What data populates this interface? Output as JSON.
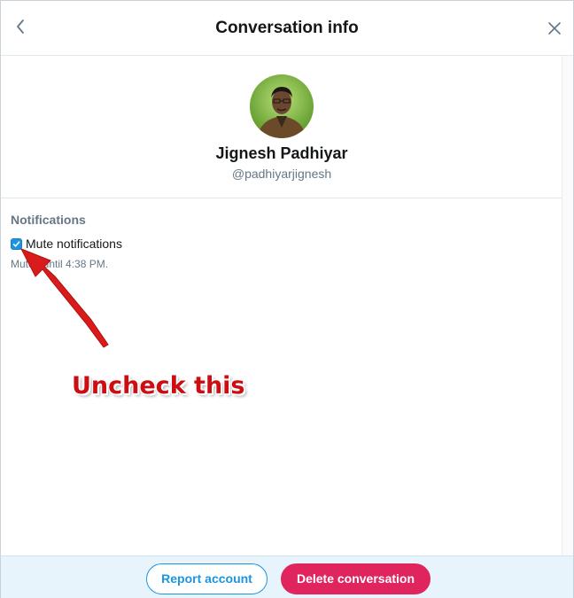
{
  "header": {
    "title": "Conversation info",
    "back_icon": "chevron-left-icon",
    "close_icon": "close-icon"
  },
  "profile": {
    "name": "Jignesh Padhiyar",
    "handle": "@padhiyarjignesh"
  },
  "notifications": {
    "heading": "Notifications",
    "mute_label": "Mute notifications",
    "mute_checked": true,
    "muted_until": "Muted until 4:38 PM."
  },
  "annotation": {
    "text": "Uncheck this",
    "color": "#cc0d12"
  },
  "footer": {
    "report_label": "Report account",
    "delete_label": "Delete conversation"
  },
  "colors": {
    "accent": "#1b95e0",
    "danger": "#e0245e",
    "footer_bg": "#e8f4fc"
  }
}
